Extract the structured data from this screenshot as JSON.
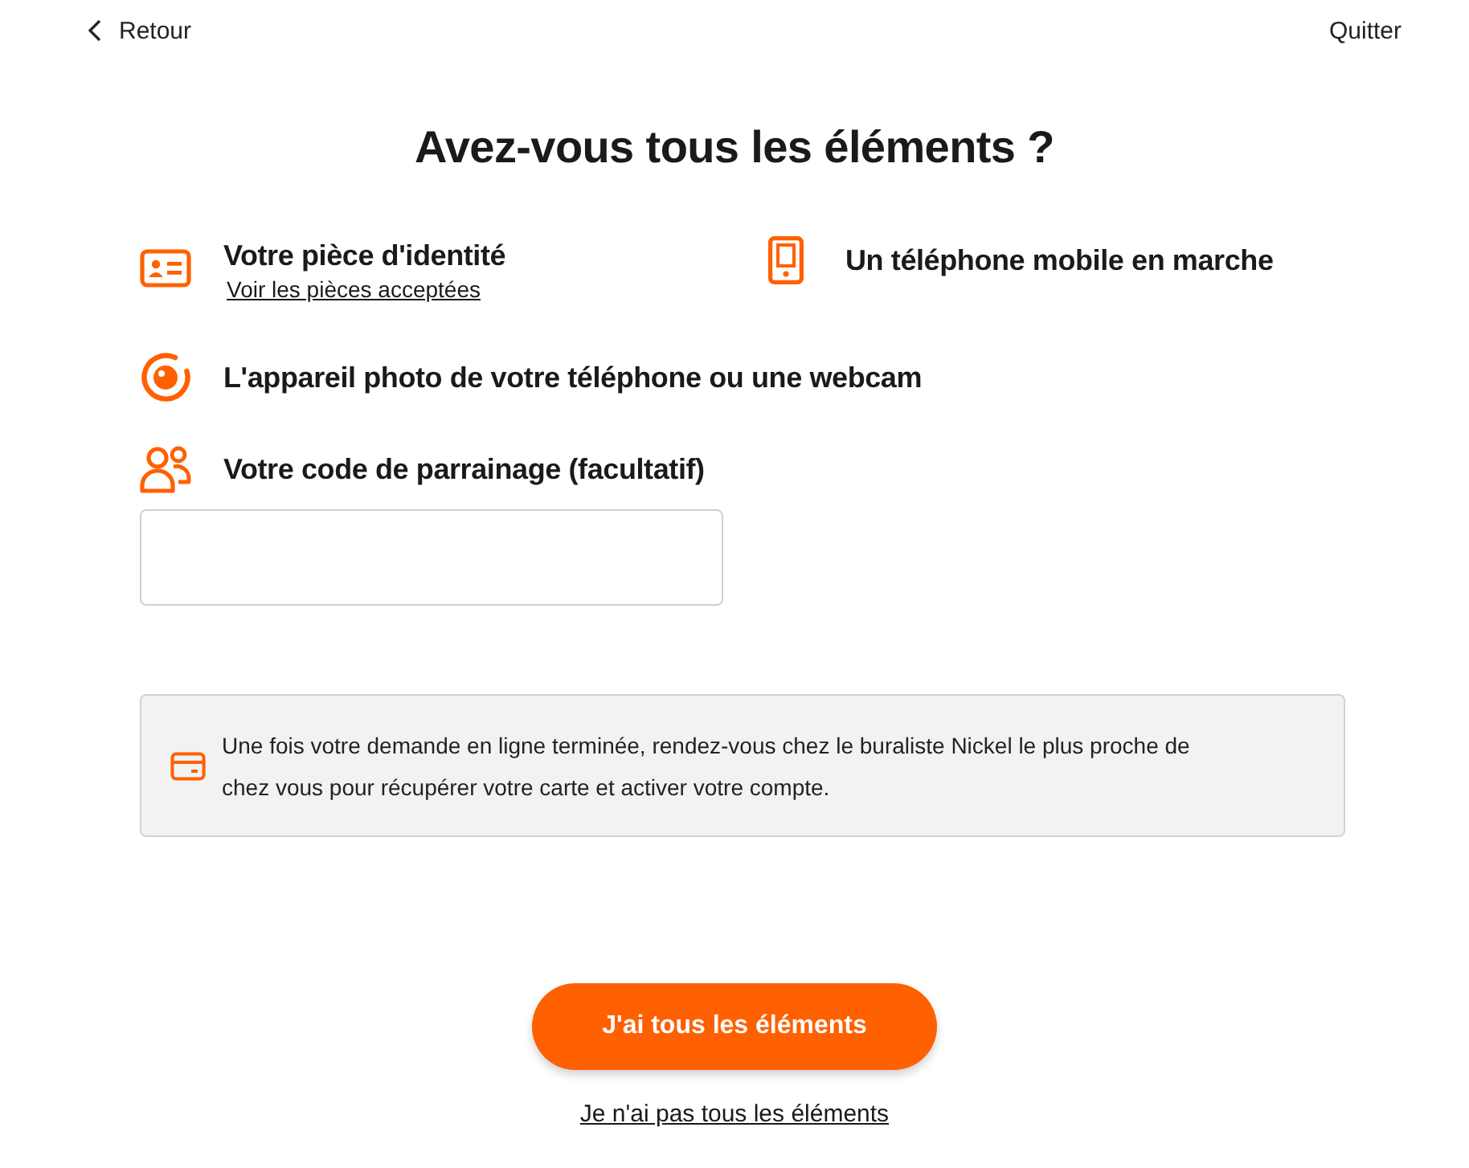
{
  "nav": {
    "back": "Retour",
    "quit": "Quitter"
  },
  "title": "Avez-vous tous les éléments ?",
  "requirements": [
    {
      "kind": "id-card",
      "label": "Votre pièce d'identité",
      "link": "Voir les pièces acceptées"
    },
    {
      "kind": "phone",
      "label": "Un téléphone mobile en marche"
    },
    {
      "kind": "camera",
      "label": "L'appareil photo de votre téléphone ou une webcam"
    },
    {
      "kind": "referral",
      "label": "Votre code de parrainage (facultatif)"
    }
  ],
  "notice": {
    "text": "Une fois votre demande en ligne terminée, rendez-vous chez le buraliste Nickel le plus proche de chez vous pour récupérer votre carte et activer votre compte."
  },
  "primary_button": "J'ai tous les éléments",
  "secondary_link": "Je n'ai pas tous les éléments"
}
